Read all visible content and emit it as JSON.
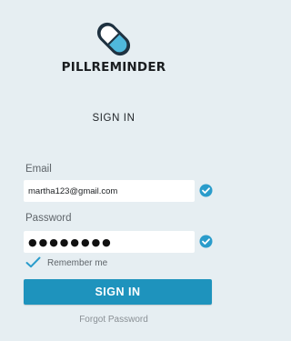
{
  "app": {
    "logo_icon": "pill-capsule-icon",
    "name": "PILLREMINDER"
  },
  "screen": {
    "title": "SIGN IN"
  },
  "form": {
    "email": {
      "label": "Email",
      "value": "martha123@gmail.com",
      "valid": true
    },
    "password": {
      "label": "Password",
      "value": "●●●●●●●●",
      "valid": true
    },
    "remember_me": {
      "label": "Remember me",
      "checked": true
    },
    "submit_label": "SIGN IN",
    "forgot_label": "Forgot Password"
  },
  "colors": {
    "background": "#e6eef2",
    "accent": "#1e93bd",
    "valid_icon": "#2a9ccb",
    "pill_dark": "#1f3241",
    "pill_light": "#4fb8dc"
  }
}
